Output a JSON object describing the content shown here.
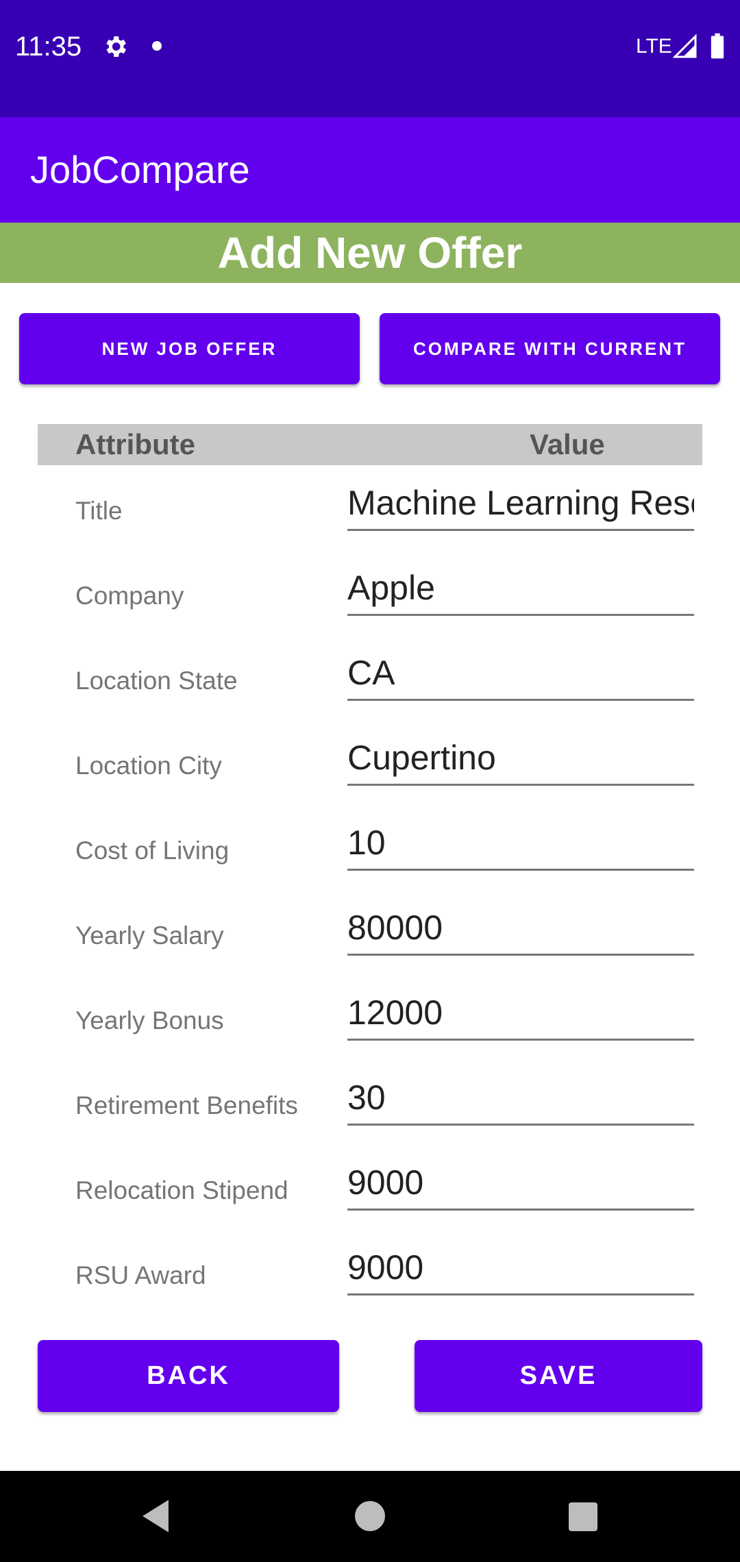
{
  "status_bar": {
    "time": "11:35",
    "network": "LTE",
    "icons": [
      "gear-icon",
      "notification-dot-icon",
      "signal-icon",
      "battery-icon"
    ]
  },
  "app_bar": {
    "title": "JobCompare",
    "color": "#6200EE"
  },
  "banner": {
    "title": "Add New Offer",
    "color": "#8DB35E"
  },
  "top_buttons": {
    "new_offer": "NEW JOB OFFER",
    "compare": "COMPARE WITH CURRENT"
  },
  "table": {
    "header_attribute": "Attribute",
    "header_value": "Value",
    "rows": [
      {
        "label": "Title",
        "value": "Machine Learning Rese"
      },
      {
        "label": "Company",
        "value": "Apple"
      },
      {
        "label": "Location State",
        "value": "CA"
      },
      {
        "label": "Location City",
        "value": "Cupertino"
      },
      {
        "label": "Cost of Living",
        "value": "10"
      },
      {
        "label": "Yearly Salary",
        "value": "80000"
      },
      {
        "label": "Yearly Bonus",
        "value": "12000"
      },
      {
        "label": "Retirement Benefits",
        "value": "30"
      },
      {
        "label": "Relocation Stipend",
        "value": "9000"
      },
      {
        "label": "RSU Award",
        "value": "9000"
      }
    ]
  },
  "bottom_buttons": {
    "back": "BACK",
    "save": "SAVE"
  },
  "nav_bar": {
    "icons": [
      "back-icon",
      "home-icon",
      "recents-icon"
    ]
  }
}
